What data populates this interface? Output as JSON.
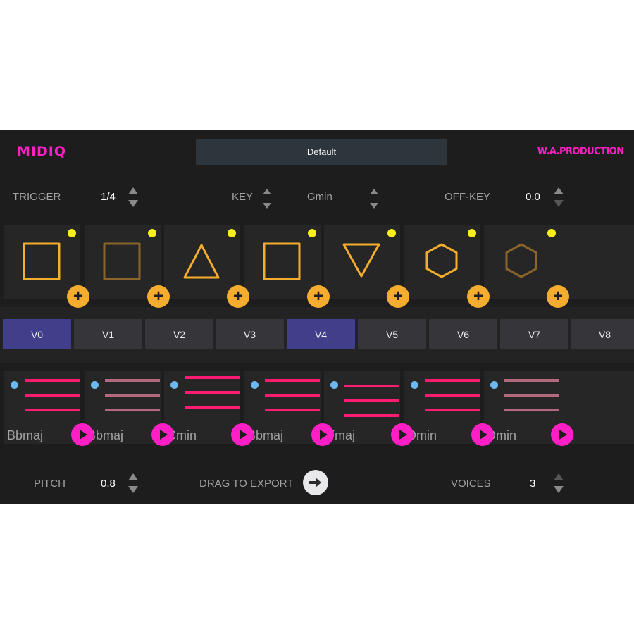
{
  "header": {
    "logo": "MIDIQ",
    "preset": "Default",
    "brand": "W.A.PRODUCTION"
  },
  "controls": {
    "trigger": {
      "label": "TRIGGER",
      "value": "1/4"
    },
    "key": {
      "label": "KEY",
      "value": "Gmin"
    },
    "off_key": {
      "label": "OFF-KEY",
      "value": "0.0"
    },
    "pitch": {
      "label": "PITCH",
      "value": "0.8"
    },
    "export": {
      "label": "DRAG TO EXPORT"
    },
    "voices": {
      "label": "VOICES",
      "value": "3"
    }
  },
  "shapes": [
    {
      "shape": "square",
      "dim": false
    },
    {
      "shape": "square",
      "dim": true
    },
    {
      "shape": "triangle-up",
      "dim": false
    },
    {
      "shape": "square",
      "dim": false
    },
    {
      "shape": "triangle-down",
      "dim": false
    },
    {
      "shape": "hexagon",
      "dim": false
    },
    {
      "shape": "hexagon",
      "dim": true
    }
  ],
  "voices_tabs": [
    {
      "label": "V0",
      "active": true
    },
    {
      "label": "V1",
      "active": false
    },
    {
      "label": "V2",
      "active": false
    },
    {
      "label": "V3",
      "active": false
    },
    {
      "label": "V4",
      "active": true
    },
    {
      "label": "V5",
      "active": false
    },
    {
      "label": "V6",
      "active": false
    },
    {
      "label": "V7",
      "active": false
    },
    {
      "label": "V8",
      "active": false
    }
  ],
  "chords": [
    {
      "name": "Bbmaj",
      "dim": false,
      "offset": 0
    },
    {
      "name": "Bbmaj",
      "dim": true,
      "offset": 0
    },
    {
      "name": "Cmin",
      "dim": false,
      "offset": -1
    },
    {
      "name": "Bbmaj",
      "dim": false,
      "offset": 0
    },
    {
      "name": "Fmaj",
      "dim": false,
      "offset": 2
    },
    {
      "name": "Dmin",
      "dim": false,
      "offset": 0
    },
    {
      "name": "Dmin",
      "dim": true,
      "offset": 0
    }
  ],
  "colors": {
    "accent": "#ff1fc4",
    "shape_stroke": "#f4ad2f",
    "shape_stroke_dim": "#8a6428",
    "bar": "#ff1a72",
    "bar_dim": "#b4687d",
    "active_tab": "#413e8a"
  },
  "icons": {
    "add": "+",
    "play": "play-icon",
    "export": "arrow-right-icon",
    "status_dot": "yellow-dot",
    "voice_dot": "blue-dot"
  }
}
